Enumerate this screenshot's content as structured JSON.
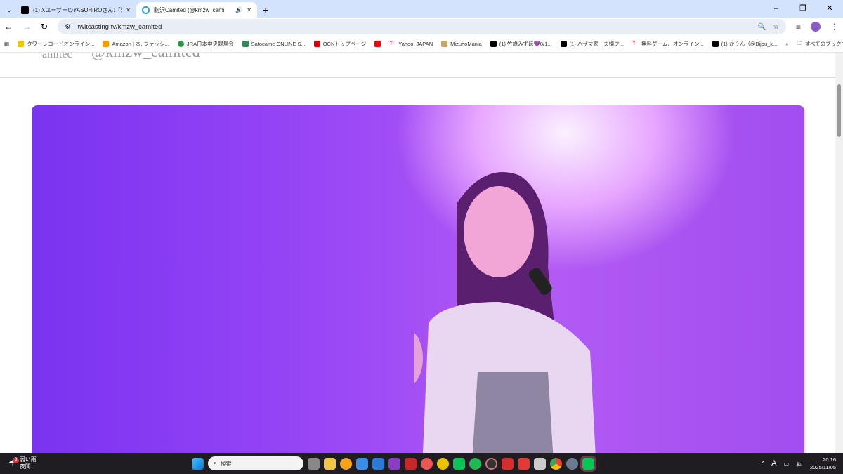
{
  "tabs": [
    {
      "title": "(1) XユーザーのYASUHIROさん:「器",
      "active": false,
      "close": "✕"
    },
    {
      "title": "駒沢Camited (@kmzw_cami",
      "active": true,
      "close": "✕",
      "audio": "🔊"
    }
  ],
  "new_tab": "+",
  "window_controls": [
    "–",
    "❐",
    "✕"
  ],
  "url": "twitcasting.tv/kmzw_camited",
  "bookmarks": [
    "タワーレコードオンライン...",
    "Amazon | 本, ファッシ...",
    "JRA日本中央競馬会",
    "Satocame ONLINE S...",
    "OCNトップページ",
    "",
    "Yahoo! JAPAN",
    "MizuhoMania",
    "(1) 竹歳みずほ💜8/1...",
    "(1) ハザマ家｜夫婦フ...",
    "無料ゲーム、オンライン...",
    "(1) かりん（@Bijou_k..."
  ],
  "bookmarks_more": "»",
  "all_bookmarks": "すべてのブックマーク",
  "page_header": {
    "logo_text": "amitec",
    "handle": "@kmzw_camited"
  },
  "taskbar": {
    "weather_badge": "3",
    "weather_line1": "弱い雨",
    "weather_line2": "夜間",
    "search_placeholder": "検索",
    "time": "20:16",
    "date": "2025/11/05",
    "ime": "A"
  }
}
